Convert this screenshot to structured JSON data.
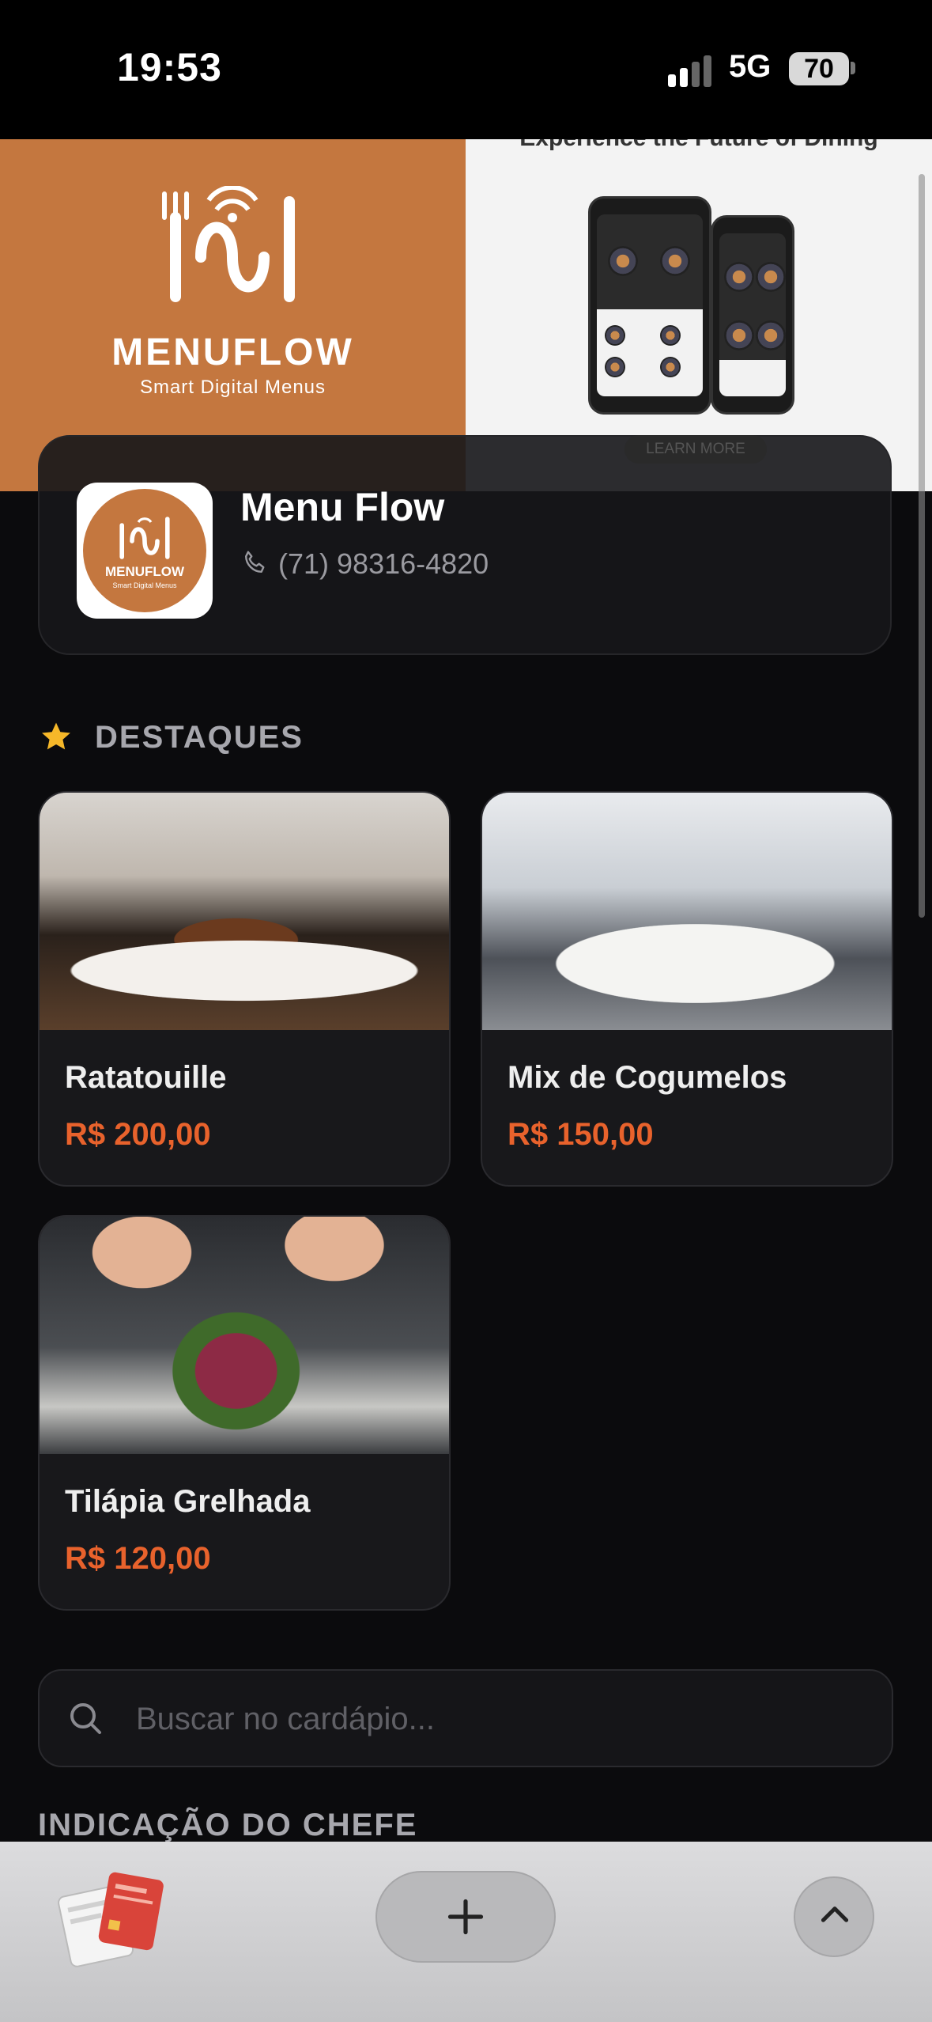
{
  "status_bar": {
    "time": "19:53",
    "network": "5G",
    "battery": "70"
  },
  "banner": {
    "brand_name": "MENUFLOW",
    "brand_tagline": "Smart Digital Menus",
    "promo_title": "Experience the Future of Dining",
    "promo_button": "LEARN MORE"
  },
  "store": {
    "name": "Menu Flow",
    "phone": "(71) 98316-4820",
    "logo_title": "MENUFLOW",
    "logo_sub": "Smart Digital Menus"
  },
  "featured": {
    "heading": "DESTAQUES",
    "items": [
      {
        "name": "Ratatouille",
        "price": "R$ 200,00"
      },
      {
        "name": "Mix de Cogumelos",
        "price": "R$ 150,00"
      },
      {
        "name": "Tilápia Grelhada",
        "price": "R$ 120,00"
      }
    ]
  },
  "search": {
    "placeholder": "Buscar no cardápio..."
  },
  "next_section": {
    "heading": "INDICAÇÃO DO CHEFE"
  },
  "colors": {
    "brand": "#c4773f",
    "price": "#e8622c",
    "background": "#0b0b0d"
  }
}
